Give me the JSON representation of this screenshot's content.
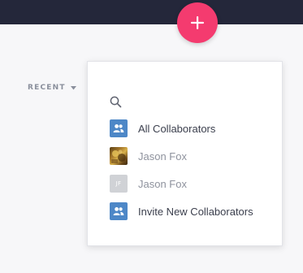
{
  "header": {
    "add_button_icon": "plus-icon",
    "add_button_color": "#f43b6f"
  },
  "filter": {
    "label": "RECENT",
    "icon": "caret-down-icon"
  },
  "collaborator_menu": {
    "search": {
      "icon": "search-icon",
      "placeholder": "",
      "value": ""
    },
    "items": [
      {
        "label": "All Collaborators",
        "icon": "group-icon",
        "style": "primary"
      },
      {
        "label": "Jason Fox",
        "icon": "photo-avatar",
        "style": "muted"
      },
      {
        "label": "Jason Fox",
        "icon": "initials-avatar",
        "initials": "JF",
        "style": "muted"
      },
      {
        "label": "Invite New Collaborators",
        "icon": "group-icon",
        "style": "primary"
      }
    ]
  },
  "colors": {
    "topbar": "#24273a",
    "accent_blue": "#4d87c7",
    "primary_text": "#3b3f4d",
    "muted_text": "#8e929d"
  }
}
